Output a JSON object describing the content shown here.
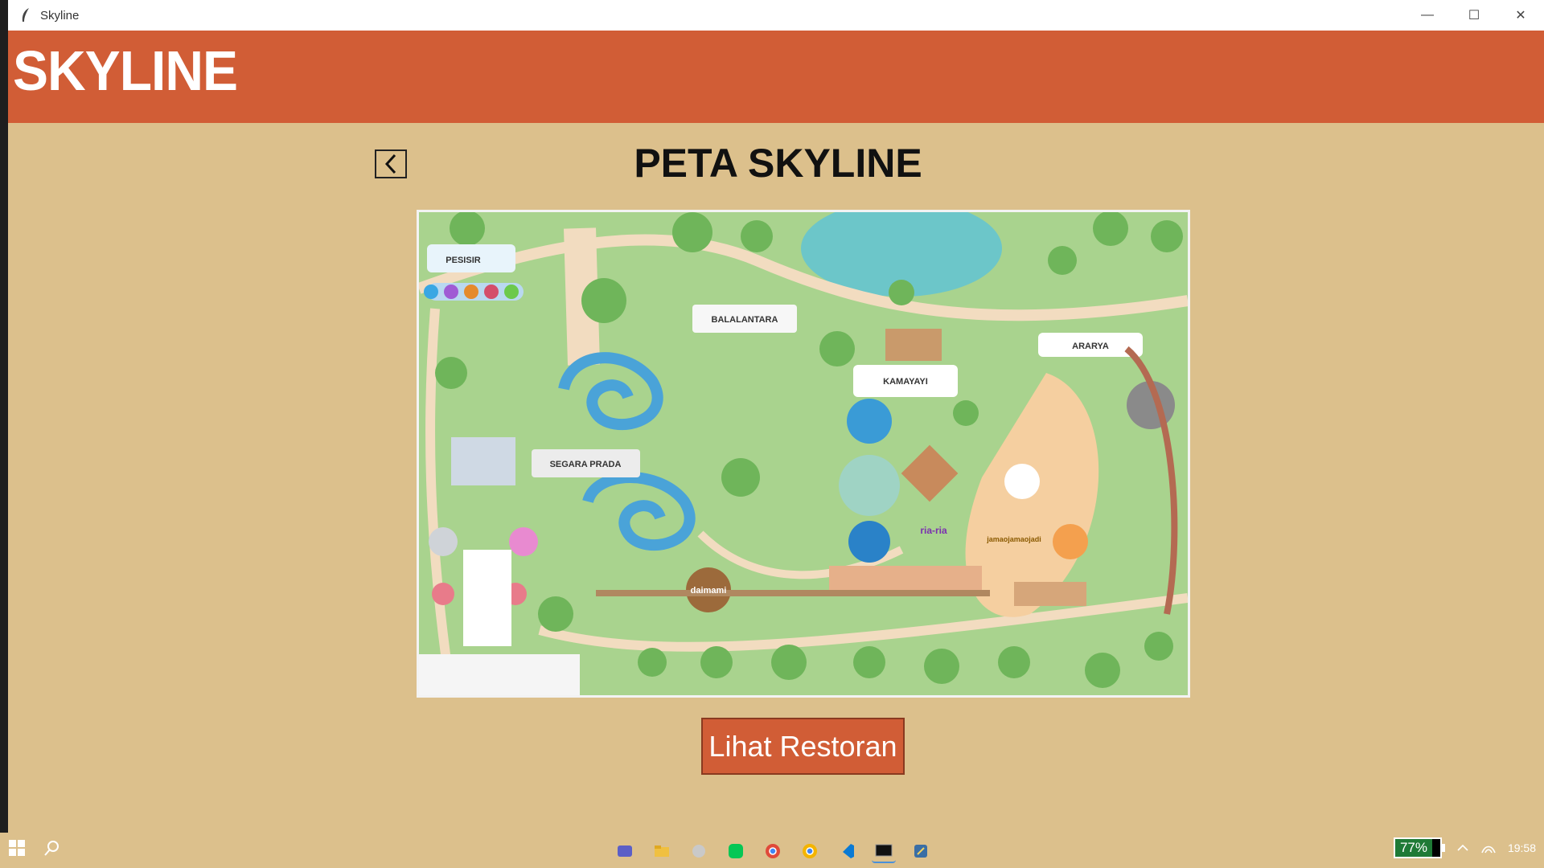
{
  "window": {
    "title": "Skyline",
    "controls": {
      "minimize": "—",
      "maximize": "☐",
      "close": "✕"
    }
  },
  "header": {
    "brand": "SKYLINE"
  },
  "page": {
    "back_icon": "‹",
    "title": "PETA SKYLINE",
    "cta_label": "Lihat Restoran"
  },
  "map": {
    "labels": [
      "PESISIR",
      "BALALANTARA",
      "ARARYA",
      "KAMAYAYI",
      "SEGARA PRADA",
      "daimami",
      "ria-ria",
      "jamaojamaojadi"
    ]
  },
  "taskbar": {
    "battery": "77%",
    "time": "19:58"
  },
  "colors": {
    "header": "#d15d36",
    "background": "#dcc08c",
    "button": "#d15d36"
  }
}
